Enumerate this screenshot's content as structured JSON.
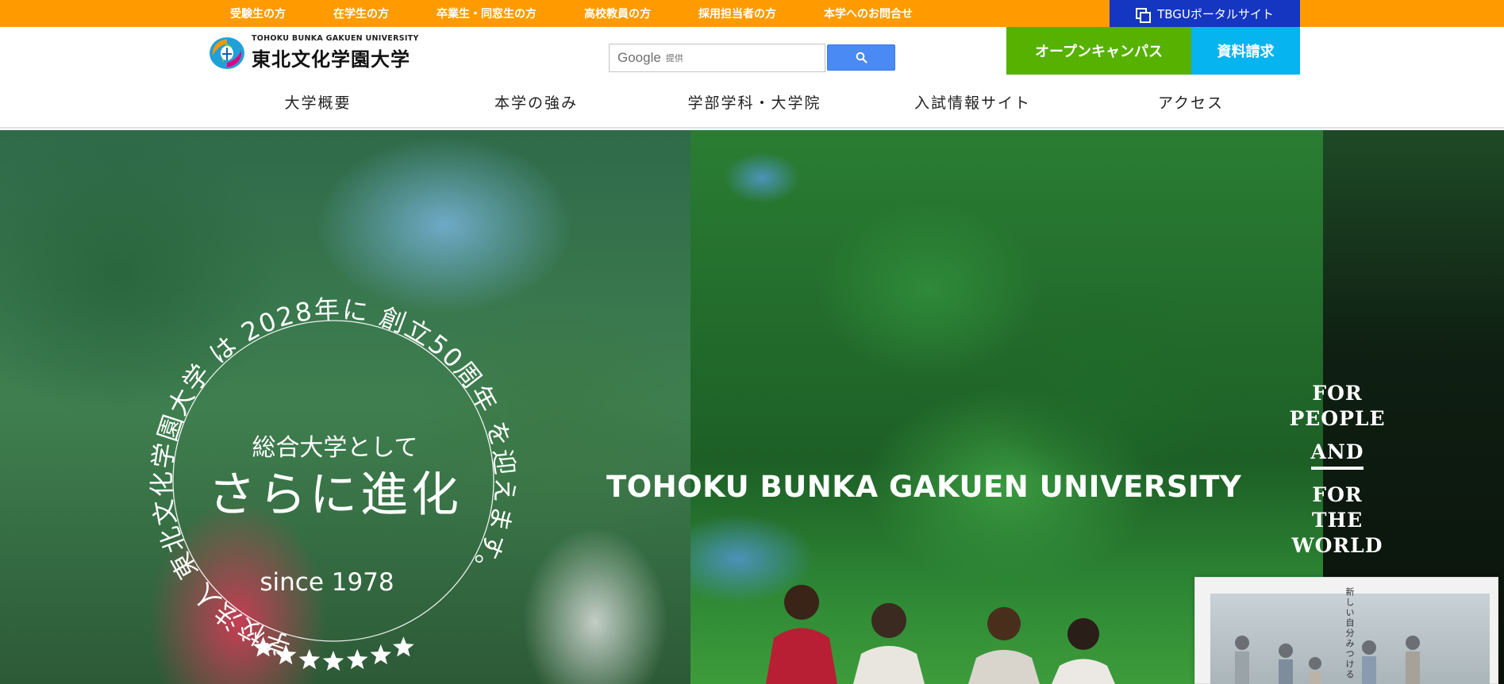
{
  "topbar": {
    "links": [
      "受験生の方",
      "在学生の方",
      "卒業生・同窓生の方",
      "高校教員の方",
      "採用担当者の方",
      "本学へのお問合せ"
    ],
    "portal_label": "TBGUポータルサイト"
  },
  "header": {
    "logo_en": "TOHOKU BUNKA GAKUEN UNIVERSITY",
    "logo_ja": "東北文化学園大学",
    "search_brand": "Google",
    "search_provided": "提供",
    "open_campus": "オープンキャンパス",
    "request_docs": "資料請求"
  },
  "nav": {
    "items": [
      "大学概要",
      "本学の強み",
      "学部学科・大学院",
      "入試情報サイト",
      "アクセス"
    ]
  },
  "hero": {
    "ring_text": "学校法人 東北文化学園大学 は 2028年に 創立50周年 を迎えます。",
    "catch_small": "総合大学として",
    "catch_large": "さらに進化",
    "since": "since 1978",
    "title": "TOHOKU BUNKA GAKUEN UNIVERSITY",
    "slogan": {
      "line1": "FOR",
      "line2": "PEOPLE",
      "and": "AND",
      "line3": "FOR",
      "line4": "THE",
      "line5": "WORLD"
    },
    "thumb_caption": "新しい自分みつける"
  },
  "colors": {
    "topbar": "#ff9b00",
    "portal": "#1536c0",
    "open_campus": "#57b100",
    "request_docs": "#06b4f0"
  }
}
